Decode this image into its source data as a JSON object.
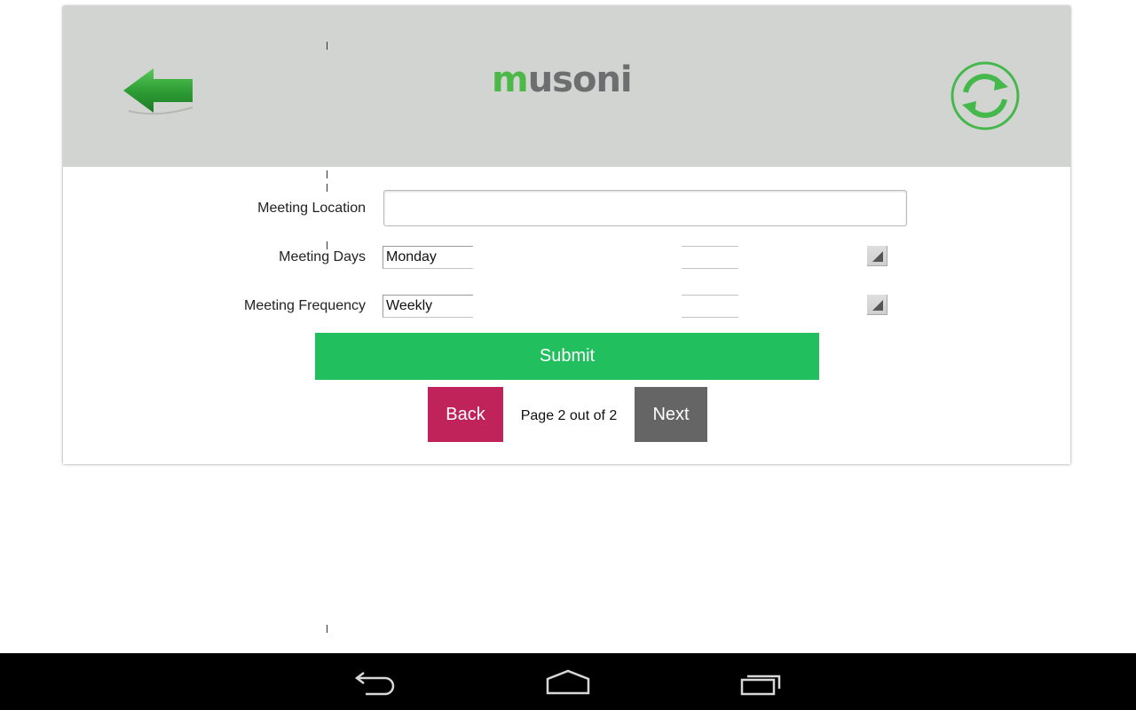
{
  "app": {
    "logo": {
      "first_letter": "m",
      "rest": "usoni"
    },
    "brand_colors": {
      "green": "#4cb848",
      "grey": "#6d6e70",
      "header_bg": "#d2d4d2"
    },
    "header": {
      "back_icon": "green-left-arrow-icon",
      "refresh_icon": "sync-refresh-icon"
    }
  },
  "form": {
    "meeting_location": {
      "label": "Meeting Location",
      "value": ""
    },
    "meeting_days": {
      "label": "Meeting Days",
      "selected": "Monday"
    },
    "meeting_frequency": {
      "label": "Meeting Frequency",
      "selected": "Weekly"
    },
    "submit_label": "Submit"
  },
  "pagination": {
    "back_label": "Back",
    "page_text": "Page 2 out of 2",
    "next_label": "Next",
    "colors": {
      "back": "#c0225a",
      "next": "#656565",
      "submit": "#22bf5f"
    }
  },
  "system_nav": {
    "back_icon": "android-back-icon",
    "home_icon": "android-home-icon",
    "recents_icon": "android-recents-icon"
  }
}
